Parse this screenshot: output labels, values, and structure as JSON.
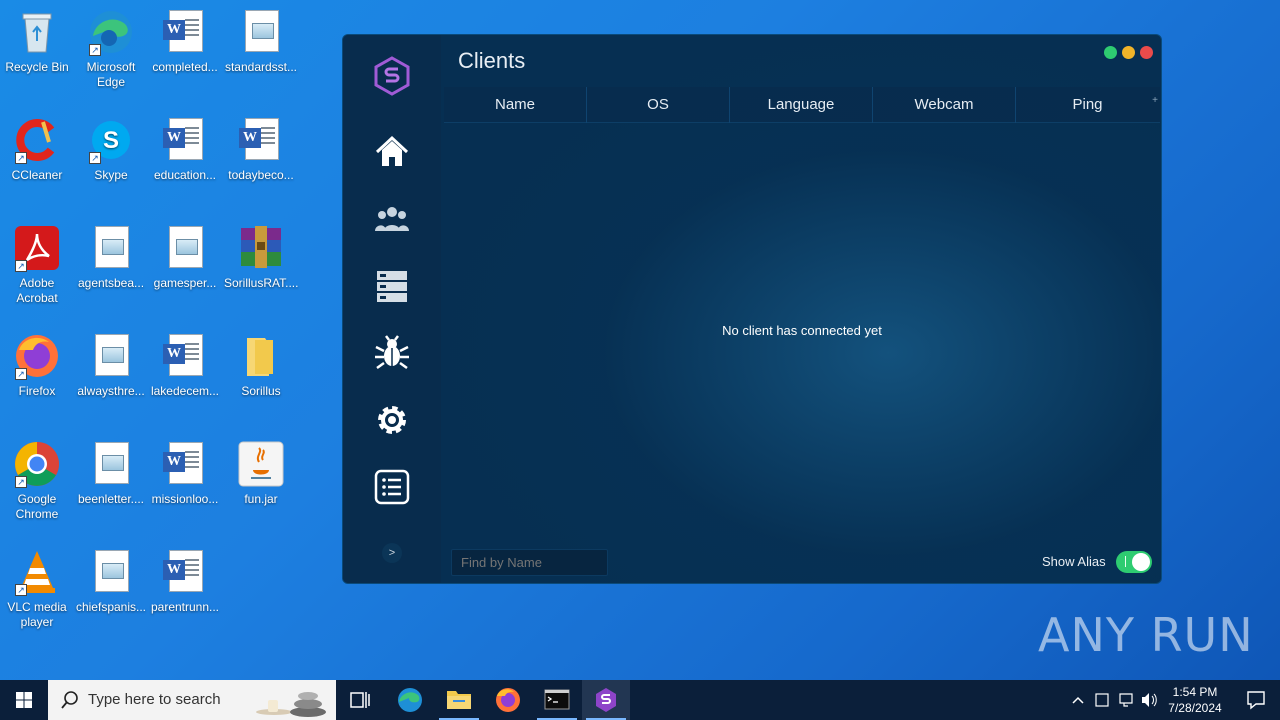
{
  "desktop": {
    "icons": [
      {
        "label": "Recycle Bin"
      },
      {
        "label": "Microsoft Edge"
      },
      {
        "label": "completed..."
      },
      {
        "label": "standardsst..."
      },
      {
        "label": "CCleaner"
      },
      {
        "label": "Skype"
      },
      {
        "label": "education..."
      },
      {
        "label": "todaybeco..."
      },
      {
        "label": "Adobe Acrobat"
      },
      {
        "label": "agentsbea..."
      },
      {
        "label": "gamesper..."
      },
      {
        "label": "SorillusRAT...."
      },
      {
        "label": "Firefox"
      },
      {
        "label": "alwaysthre..."
      },
      {
        "label": "lakedecem..."
      },
      {
        "label": "Sorillus"
      },
      {
        "label": "Google Chrome"
      },
      {
        "label": "beenletter...."
      },
      {
        "label": "missionloo..."
      },
      {
        "label": "fun.jar"
      },
      {
        "label": "VLC media player"
      },
      {
        "label": "chiefspanis..."
      },
      {
        "label": "parentrunn..."
      }
    ]
  },
  "app": {
    "title": "Clients",
    "columns": [
      "Name",
      "OS",
      "Language",
      "Webcam",
      "Ping"
    ],
    "empty_message": "No client has connected yet",
    "search_placeholder": "Find by Name",
    "show_alias_label": "Show Alias",
    "show_alias_on": true,
    "collapse_label": ">",
    "accent_colors": {
      "close": "#e94b4b",
      "minimize": "#f0b429",
      "maximize": "#2ecc71",
      "toggle": "#2ecc71"
    },
    "nav_icons": [
      "home-icon",
      "users-icon",
      "servers-icon",
      "bug-icon",
      "settings-icon",
      "list-icon"
    ]
  },
  "taskbar": {
    "search_placeholder": "Type here to search",
    "time": "1:54 PM",
    "date": "7/28/2024"
  },
  "watermark": "ANY RUN"
}
